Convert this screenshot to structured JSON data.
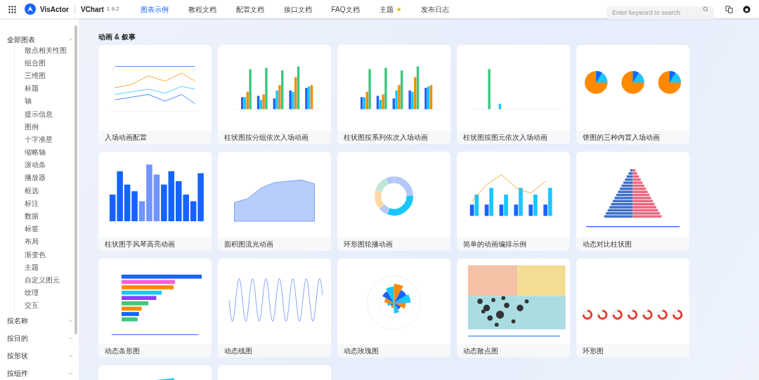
{
  "header": {
    "brand": "VisActor",
    "product": "VChart",
    "version": "1.9.2",
    "nav": [
      {
        "label": "图表示例",
        "selected": true
      },
      {
        "label": "教程文档",
        "selected": false
      },
      {
        "label": "配置文档",
        "selected": false
      },
      {
        "label": "接口文档",
        "selected": false
      },
      {
        "label": "FAQ文档",
        "selected": false
      },
      {
        "label": "主题",
        "selected": false,
        "kind": "theme"
      },
      {
        "label": "发布日志",
        "selected": false
      }
    ],
    "search": {
      "placeholder": "Enter keyword to search"
    }
  },
  "sidebar": [
    {
      "label": "全部图表",
      "expanded": true,
      "children": [
        "散点相关性图",
        "组合图",
        "三维图",
        "标题",
        "轴",
        "提示信息",
        "图例",
        "十字准星",
        "缩略轴",
        "滚动条",
        "播放器",
        "框选",
        "标注",
        "数据",
        "标签",
        "布局",
        "渐变色",
        "主题",
        "自定义图元",
        "纹理",
        "交互"
      ]
    },
    {
      "label": "按名称",
      "expanded": false
    },
    {
      "label": "按目的",
      "expanded": false
    },
    {
      "label": "按形状",
      "expanded": false
    },
    {
      "label": "按组件",
      "expanded": false
    }
  ],
  "section_title": "动画 & 叙事",
  "cards": [
    {
      "kind": "lines",
      "caption": "入场动画配置"
    },
    {
      "kind": "groupbars",
      "caption": "柱状图按分组依次入场动画"
    },
    {
      "kind": "groupbars",
      "caption": "柱状图按系列依次入场动画"
    },
    {
      "kind": "sparsebars",
      "caption": "柱状图按图元依次入场动画"
    },
    {
      "kind": "pies",
      "caption": "饼图的三种内置入场动画"
    },
    {
      "kind": "bluebars",
      "caption": "柱状图手风琴高亮动画"
    },
    {
      "kind": "area",
      "caption": "面积图流光动画"
    },
    {
      "kind": "donut",
      "caption": "环形图轮播动画"
    },
    {
      "kind": "barline",
      "caption": "简单的动画编排示例"
    },
    {
      "kind": "pyramid",
      "caption": "动态对比柱状图"
    },
    {
      "kind": "race",
      "caption": "动态条形图"
    },
    {
      "kind": "wave",
      "caption": "动态线图"
    },
    {
      "kind": "rose",
      "caption": "动态玫瑰图"
    },
    {
      "kind": "scatter",
      "caption": "动态散点图"
    },
    {
      "kind": "rings",
      "caption": "环形图"
    },
    {
      "kind": "partial-bar"
    },
    {
      "kind": "partial-blank"
    }
  ]
}
